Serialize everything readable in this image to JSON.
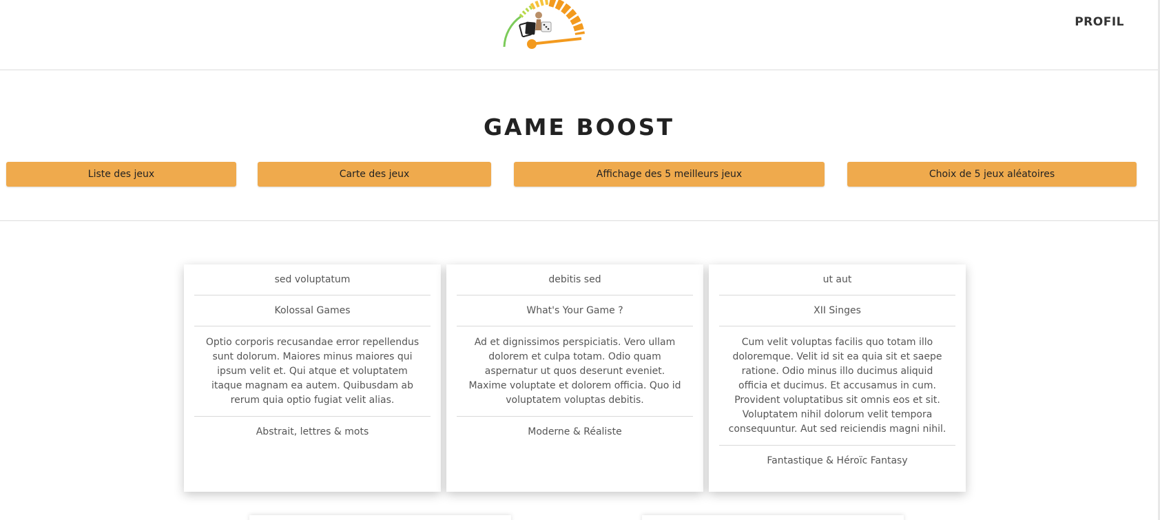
{
  "header": {
    "logo_alt": "Game Boost",
    "profile_label": "PROFIL"
  },
  "hero": {
    "title": "GAME BOOST",
    "buttons": [
      {
        "label": "Liste des jeux"
      },
      {
        "label": "Carte des jeux"
      },
      {
        "label": "Affichage des 5 meilleurs jeux"
      },
      {
        "label": "Choix de 5 jeux aléatoires"
      }
    ]
  },
  "cards": [
    {
      "name": "sed voluptatum",
      "publisher": "Kolossal Games",
      "description": "Optio corporis recusandae error repellendus sunt dolorum. Maiores minus maiores qui ipsum velit et. Qui atque et voluptatem itaque magnam ea autem. Quibusdam ab rerum quia optio fugiat velit alias.",
      "theme": "Abstrait, lettres & mots"
    },
    {
      "name": "debitis sed",
      "publisher": "What's Your Game ?",
      "description": "Ad et dignissimos perspiciatis. Vero ullam dolorem et culpa totam. Odio quam aspernatur ut quos deserunt eveniet. Maxime voluptate et dolorem officia. Quo id voluptatem voluptas debitis.",
      "theme": "Moderne & Réaliste"
    },
    {
      "name": "ut aut",
      "publisher": "XII Singes",
      "description": "Cum velit voluptas facilis quo totam illo doloremque. Velit id sit ea quia sit et saepe ratione. Odio minus illo ducimus aliquid officia et ducimus. Et accusamus in cum. Provident voluptatibus sit omnis eos et sit. Voluptatem nihil dolorum velit tempora consequuntur. Aut sed reiciendis magni nihil.",
      "theme": "Fantastique & Héroïc Fantasy"
    }
  ],
  "colors": {
    "accent": "#efaa4d",
    "gauge_orange": "#f39a1e",
    "gauge_green": "#7ccb5a"
  }
}
